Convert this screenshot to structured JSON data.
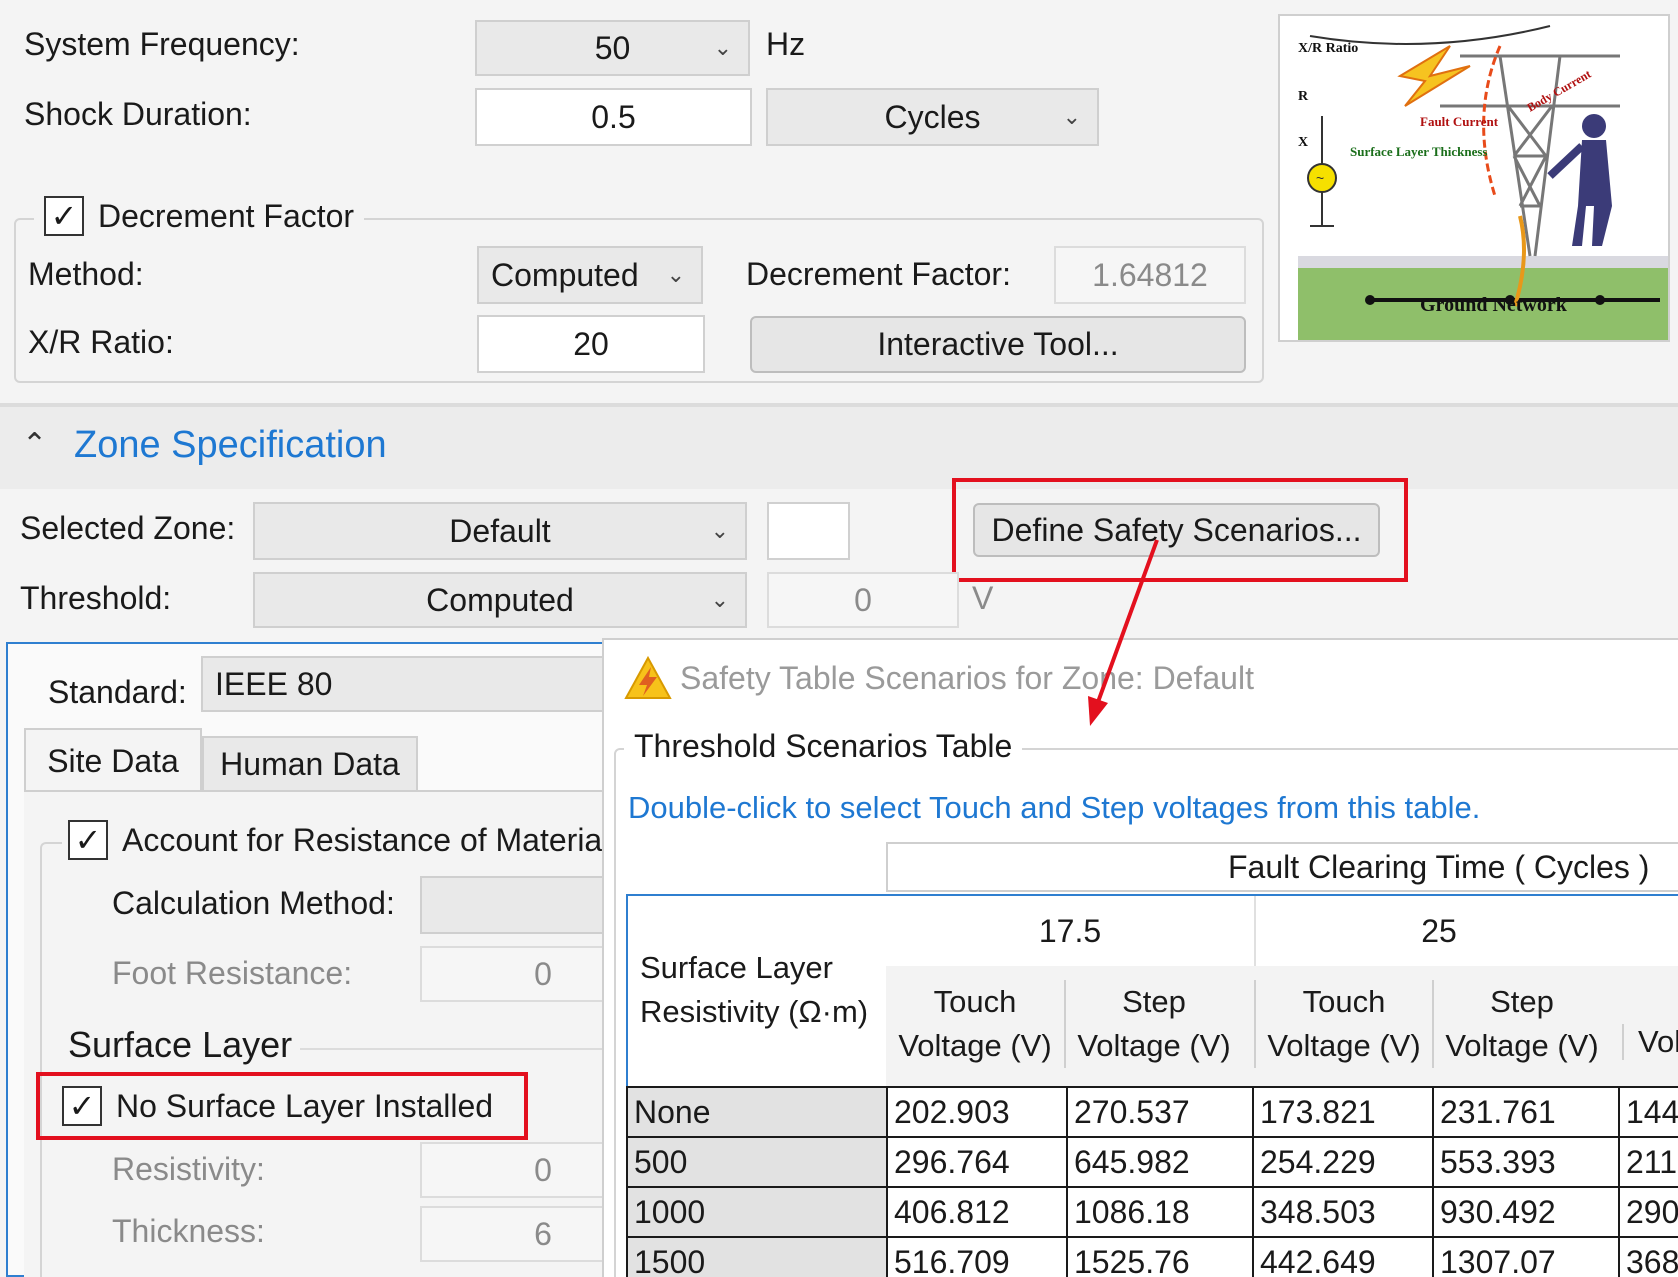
{
  "general": {
    "system_frequency_label": "System Frequency:",
    "system_frequency_value": "50",
    "system_frequency_unit": "Hz",
    "shock_duration_label": "Shock Duration:",
    "shock_duration_value": "0.5",
    "shock_duration_unit": "Cycles"
  },
  "decrement": {
    "group_label": "Decrement Factor",
    "checked": true,
    "method_label": "Method:",
    "method_value": "Computed",
    "factor_label": "Decrement Factor:",
    "factor_value": "1.64812",
    "xr_label": "X/R Ratio:",
    "xr_value": "20",
    "interactive_button": "Interactive Tool..."
  },
  "illustration": {
    "xr_ratio": "X/R Ratio",
    "r": "R",
    "x": "X",
    "fault_current": "Fault Current",
    "body_current": "Body Current",
    "surface_layer_thickness": "Surface Layer Thickness",
    "ground_network": "Ground Network"
  },
  "zone": {
    "section_title": "Zone Specification",
    "selected_zone_label": "Selected Zone:",
    "selected_zone_value": "Default",
    "threshold_label": "Threshold:",
    "threshold_value": "Computed",
    "threshold_number": "0",
    "threshold_unit": "V",
    "define_button": "Define Safety Scenarios..."
  },
  "safety_panel": {
    "standard_label": "Standard:",
    "standard_value": "IEEE 80",
    "tabs": [
      "Site Data",
      "Human Data"
    ],
    "account_label": "Account for Resistance of Materia",
    "account_checked": true,
    "calc_method_label": "Calculation Method:",
    "foot_resistance_label": "Foot Resistance:",
    "foot_resistance_value": "0",
    "surface_layer_title": "Surface Layer",
    "no_surface_label": "No Surface Layer Installed",
    "no_surface_checked": true,
    "resistivity_label": "Resistivity:",
    "resistivity_value": "0",
    "thickness_label": "Thickness:",
    "thickness_value": "6"
  },
  "dialog": {
    "title": "Safety Table Scenarios for Zone: Default",
    "group_title": "Threshold Scenarios Table",
    "hint": "Double-click to select Touch and Step voltages from this table.",
    "header_span": "Fault Clearing Time  ( Cycles )",
    "row_header_line1": "Surface Layer",
    "row_header_line2": "Resistivity (Ω·m)",
    "times": [
      "17.5",
      "25"
    ],
    "touch_line1": "Touch",
    "step_line1": "Step",
    "voltage_line2": "Voltage (V)",
    "partial_col": "Vol",
    "rows": [
      {
        "label": "None",
        "cells": [
          "202.903",
          "270.537",
          "173.821",
          "231.761",
          "144"
        ]
      },
      {
        "label": "500",
        "cells": [
          "296.764",
          "645.982",
          "254.229",
          "553.393",
          "211"
        ]
      },
      {
        "label": "1000",
        "cells": [
          "406.812",
          "1086.18",
          "348.503",
          "930.492",
          "290"
        ]
      },
      {
        "label": "1500",
        "cells": [
          "516.709",
          "1525.76",
          "442.649",
          "1307.07",
          "368"
        ]
      }
    ]
  },
  "colors": {
    "accent_blue": "#1e78d2",
    "highlight_red": "#e3101e"
  }
}
